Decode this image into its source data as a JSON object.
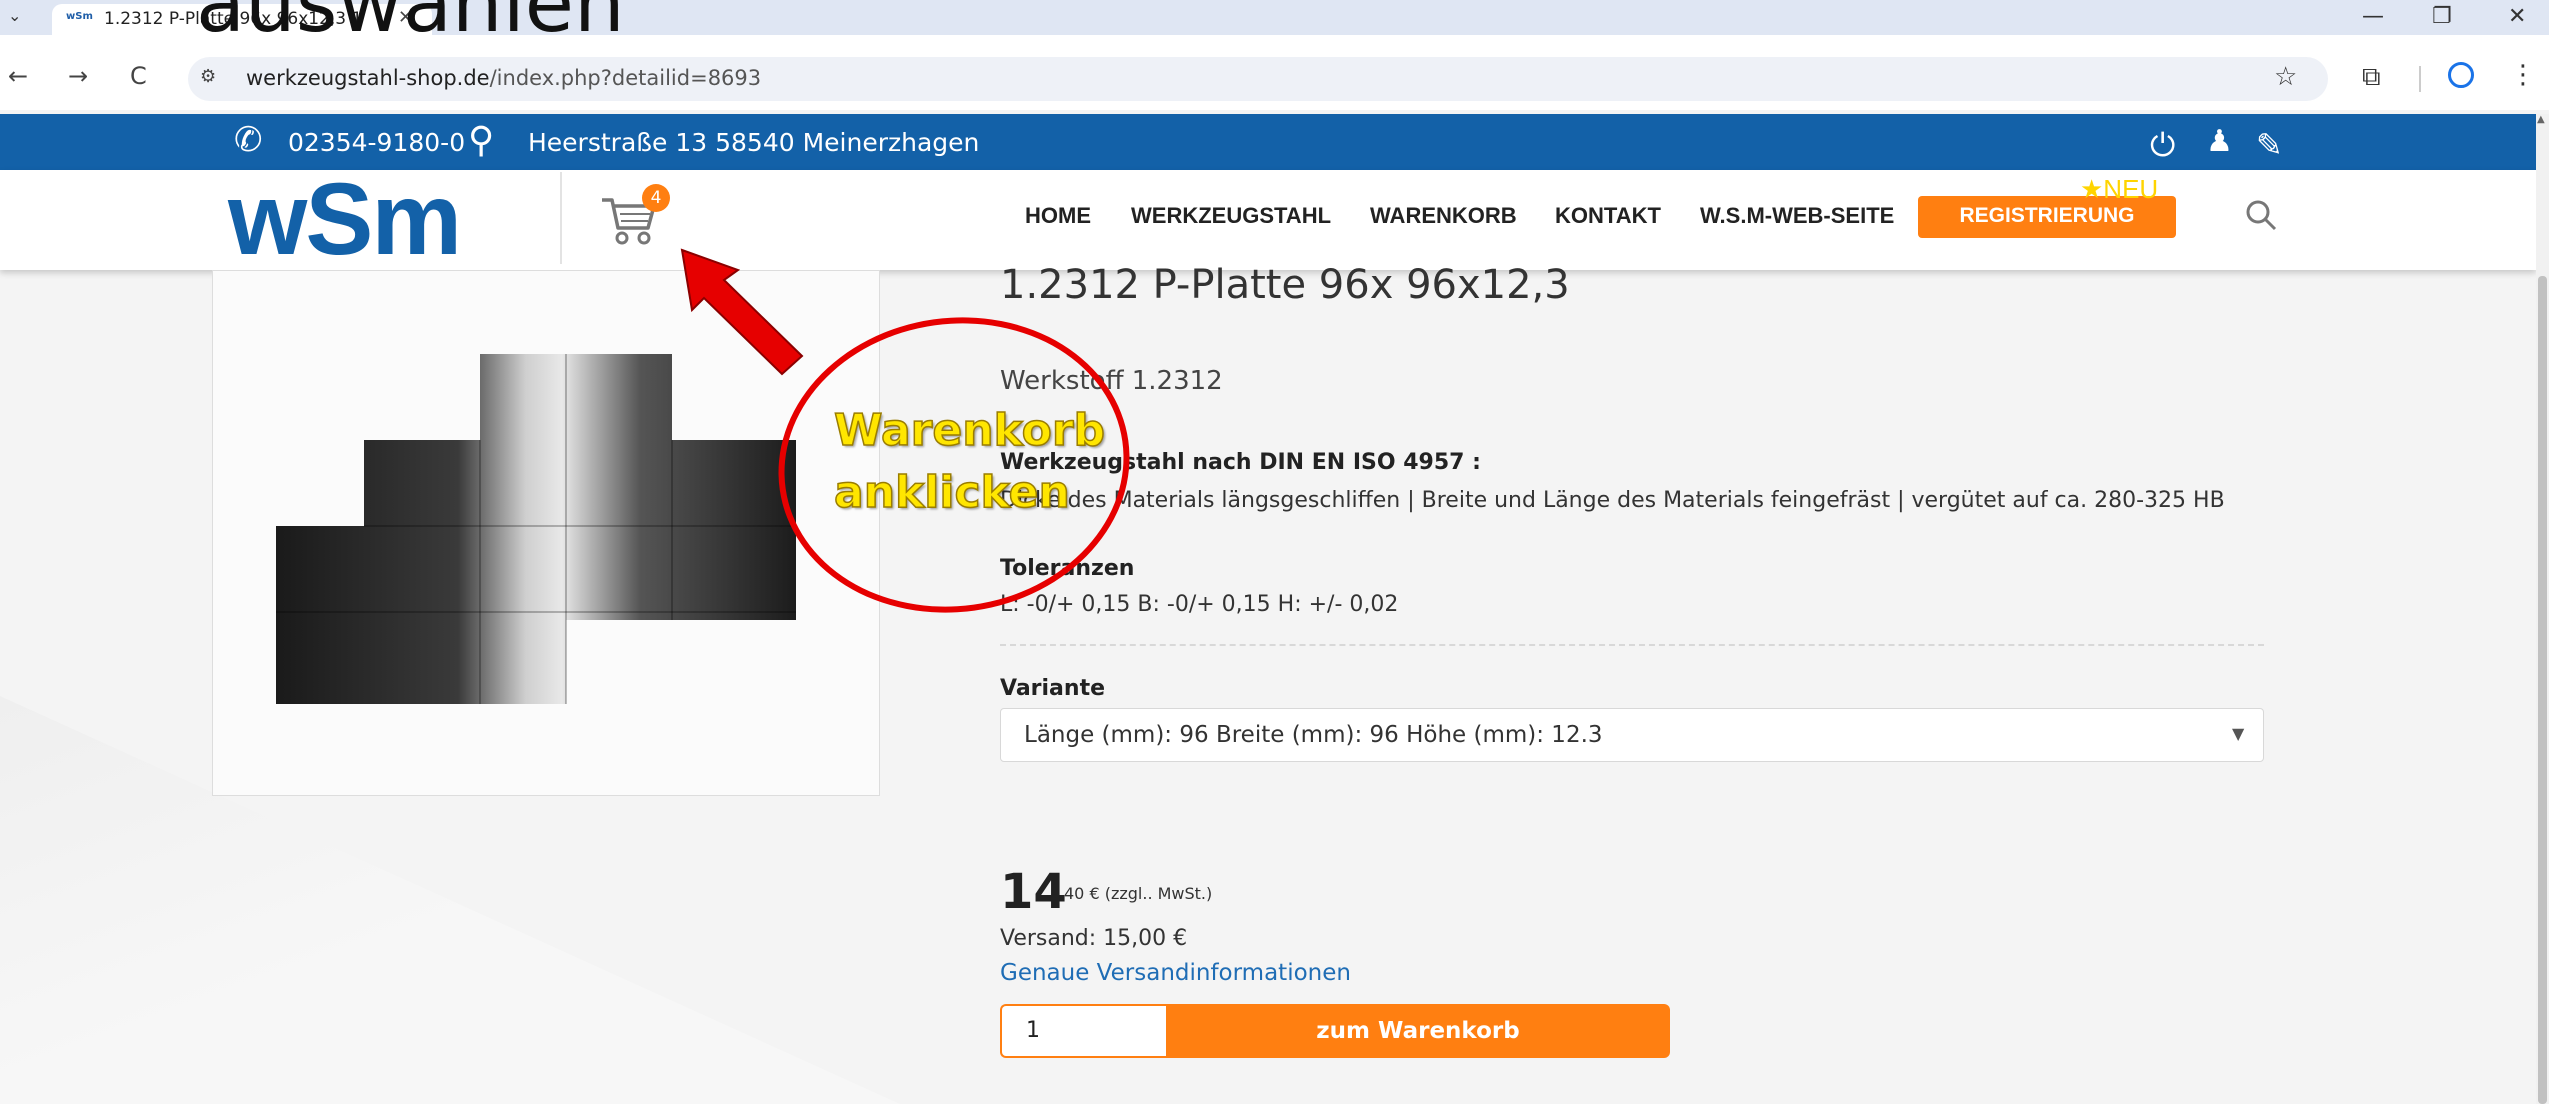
{
  "browser": {
    "tab_title": "1.2312 P-Platte 96x 96x12,3 1",
    "tab_close": "✕",
    "favicon_text": "wSm",
    "chevron": "⌄",
    "url_host": "werkzeugstahl-shop.de",
    "url_path": "/index.php?detailid=8693",
    "window_controls": [
      "—",
      "❐",
      "✕"
    ],
    "nav_icons": [
      "←",
      "→",
      "C"
    ]
  },
  "overlay": {
    "title": "auswählen",
    "callout_line1": "Warenkorb",
    "callout_line2": "anklicken"
  },
  "topbar": {
    "phone": "02354-9180-0",
    "address": "Heerstraße 13 58540 Meinerzhagen",
    "bg_color": "#1361a8"
  },
  "header": {
    "logo": "wSm",
    "cart_count": "4",
    "nav": [
      "HOME",
      "WERKZEUGSTAHL",
      "WARENKORB",
      "KONTAKT",
      "W.S.M-WEB-SEITE"
    ],
    "register": "REGISTRIERUNG",
    "neu_badge": "★NEU",
    "accent": "#ff7f11"
  },
  "product": {
    "title": "1.2312 P-Platte 96x 96x12,3",
    "material": "Werkstoff 1.2312",
    "desc_heading": "Werkzeugstahl nach DIN EN ISO 4957 :",
    "desc_text": "Dicke des Materials längsgeschliffen | Breite und Länge des Materials feingefräst | vergütet auf ca. 280-325 HB",
    "tolerance_heading": "Toleranzen",
    "tolerance_values": "L: -0/+ 0,15 B: -0/+ 0,15 H: +/- 0,02",
    "variant_label": "Variante",
    "variant_value": "Länge (mm): 96 Breite (mm): 96 Höhe (mm): 12.3",
    "price_int": "14",
    "price_rest": "40 € (zzgl.. MwSt.)",
    "shipping": "Versand: 15,00 €",
    "shipping_link": "Genaue Versandinformationen",
    "quantity": "1",
    "add_to_cart": "zum Warenkorb"
  }
}
